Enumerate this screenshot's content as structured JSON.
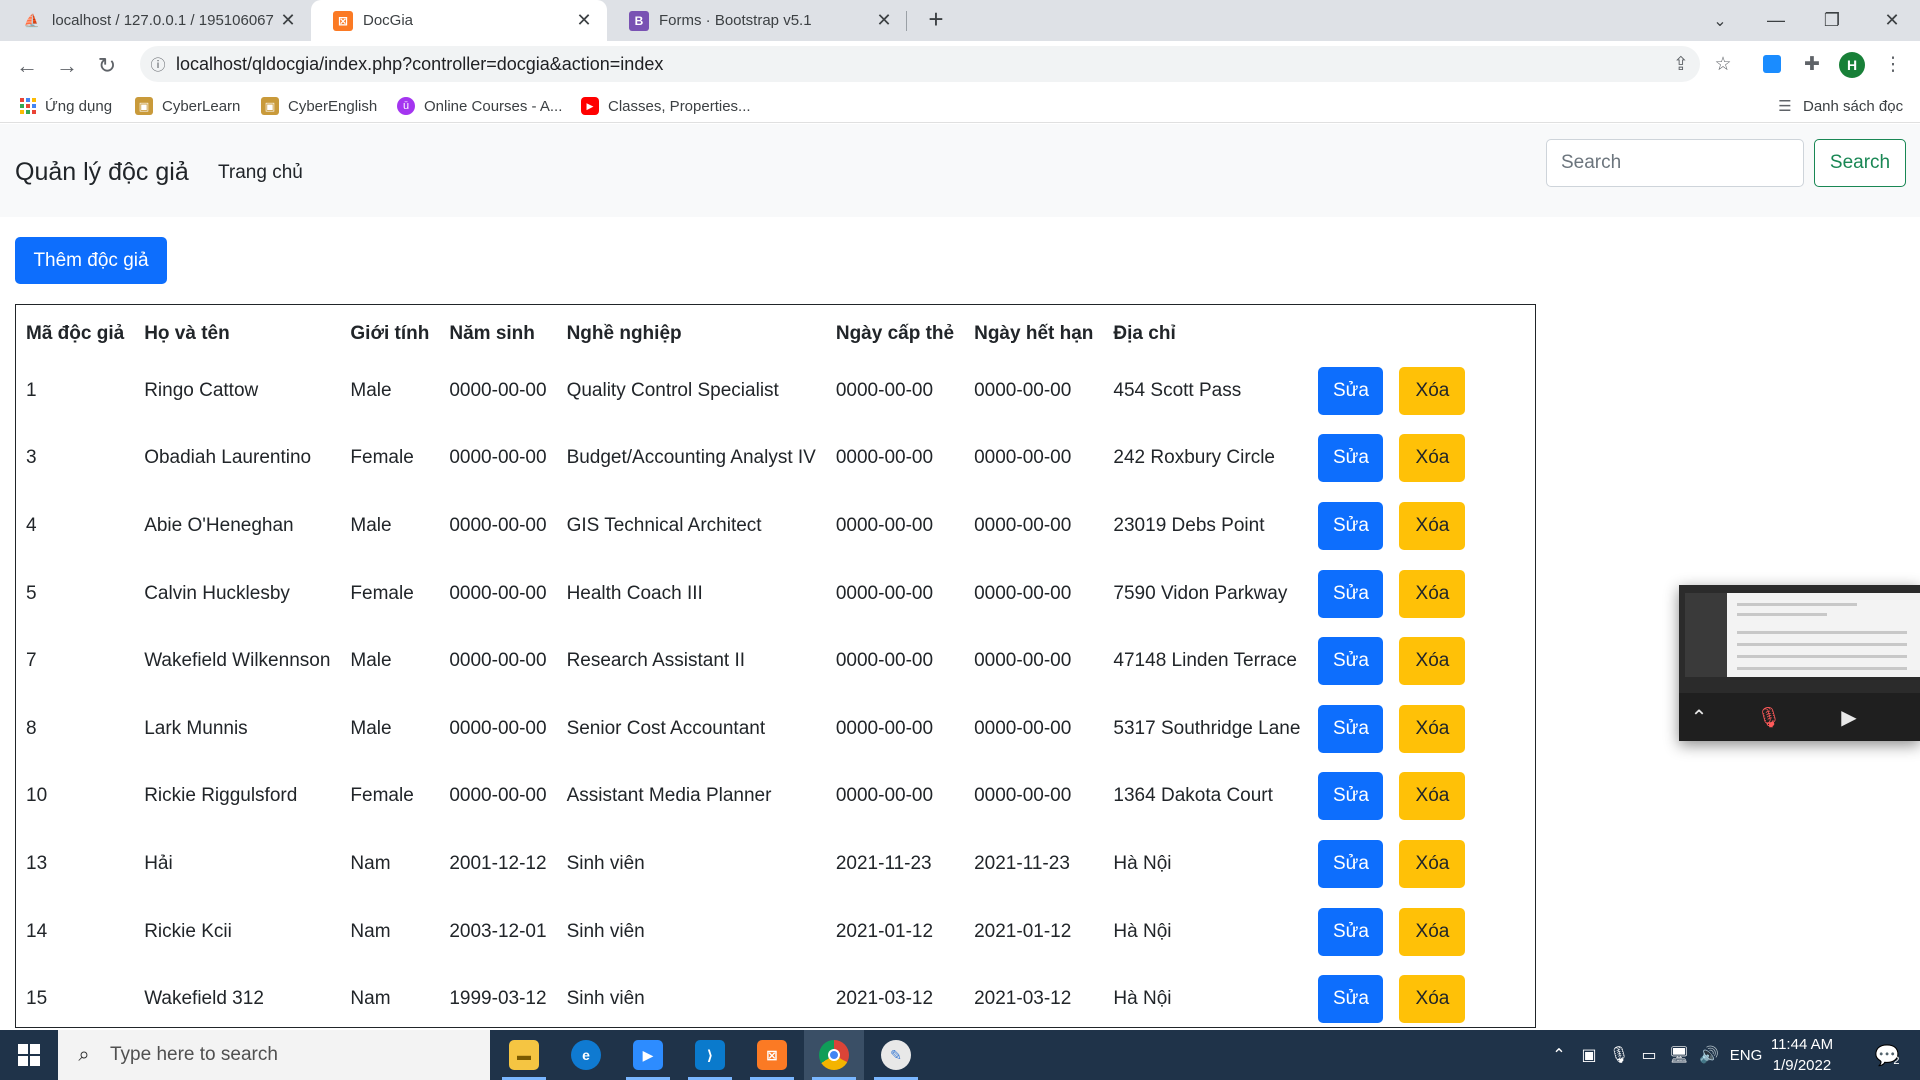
{
  "browser": {
    "tabs": [
      {
        "title": "localhost / 127.0.0.1 / 195106067",
        "icon": "phpmyadmin-icon",
        "active": false
      },
      {
        "title": "DocGia",
        "icon": "xampp-icon",
        "active": true
      },
      {
        "title": "Forms · Bootstrap v5.1",
        "icon": "bootstrap-icon",
        "active": false
      }
    ],
    "new_tab": "+",
    "url": "localhost/qldocgia/index.php?controller=docgia&action=index",
    "profile_initial": "H",
    "bookmarks": [
      {
        "label": "Ứng dụng",
        "icon": "apps-icon"
      },
      {
        "label": "CyberLearn",
        "icon": "cyberlearn-icon"
      },
      {
        "label": "CyberEnglish",
        "icon": "cyberenglish-icon"
      },
      {
        "label": "Online Courses - A...",
        "icon": "udemy-icon"
      },
      {
        "label": "Classes, Properties...",
        "icon": "youtube-icon"
      }
    ],
    "reading_list": "Danh sách đọc"
  },
  "navbar": {
    "brand": "Quản lý độc giả",
    "home_link": "Trang chủ",
    "search_placeholder": "Search",
    "search_button": "Search"
  },
  "add_button": "Thêm độc giả",
  "table": {
    "headers": [
      "Mã độc giả",
      "Họ và tên",
      "Giới tính",
      "Năm sinh",
      "Nghề nghiệp",
      "Ngày cấp thẻ",
      "Ngày hết hạn",
      "Địa chỉ"
    ],
    "edit_label": "Sửa",
    "delete_label": "Xóa",
    "rows": [
      [
        "1",
        "Ringo Cattow",
        "Male",
        "0000-00-00",
        "Quality Control Specialist",
        "0000-00-00",
        "0000-00-00",
        "454 Scott Pass"
      ],
      [
        "3",
        "Obadiah Laurentino",
        "Female",
        "0000-00-00",
        "Budget/Accounting Analyst IV",
        "0000-00-00",
        "0000-00-00",
        "242 Roxbury Circle"
      ],
      [
        "4",
        "Abie O'Heneghan",
        "Male",
        "0000-00-00",
        "GIS Technical Architect",
        "0000-00-00",
        "0000-00-00",
        "23019 Debs Point"
      ],
      [
        "5",
        "Calvin Hucklesby",
        "Female",
        "0000-00-00",
        "Health Coach III",
        "0000-00-00",
        "0000-00-00",
        "7590 Vidon Parkway"
      ],
      [
        "7",
        "Wakefield Wilkennson",
        "Male",
        "0000-00-00",
        "Research Assistant II",
        "0000-00-00",
        "0000-00-00",
        "47148 Linden Terrace"
      ],
      [
        "8",
        "Lark Munnis",
        "Male",
        "0000-00-00",
        "Senior Cost Accountant",
        "0000-00-00",
        "0000-00-00",
        "5317 Southridge Lane"
      ],
      [
        "10",
        "Rickie Riggulsford",
        "Female",
        "0000-00-00",
        "Assistant Media Planner",
        "0000-00-00",
        "0000-00-00",
        "1364 Dakota Court"
      ],
      [
        "13",
        "Hải",
        "Nam",
        "2001-12-12",
        "Sinh viên",
        "2021-11-23",
        "2021-11-23",
        "Hà Nội"
      ],
      [
        "14",
        "Rickie Kcii",
        "Nam",
        "2003-12-01",
        "Sinh viên",
        "2021-01-12",
        "2021-01-12",
        "Hà Nội"
      ],
      [
        "15",
        "Wakefield 312",
        "Nam",
        "1999-03-12",
        "Sinh viên",
        "2021-03-12",
        "2021-03-12",
        "Hà Nội"
      ]
    ]
  },
  "taskbar": {
    "search_placeholder": "Type here to search",
    "apps": [
      "file-explorer-icon",
      "edge-icon",
      "zoom-icon",
      "vscode-icon",
      "xampp-icon",
      "chrome-icon",
      "paint-icon"
    ],
    "language": "ENG",
    "time": "11:44 AM",
    "date": "1/9/2022",
    "notification_count": "2"
  },
  "colors": {
    "primary": "#0d6efd",
    "warning": "#ffc107",
    "success": "#198754",
    "taskbar": "#1f3349"
  }
}
